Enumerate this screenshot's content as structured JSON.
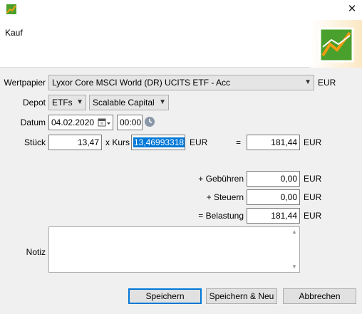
{
  "window": {
    "title": "Kauf",
    "close_glyph": "✕",
    "app_icon": "chart-app-icon",
    "header_icon": "chart-logo-icon"
  },
  "form": {
    "wertpapier": {
      "label": "Wertpapier",
      "value": "Lyxor Core MSCI World (DR) UCITS ETF - Acc",
      "currency": "EUR"
    },
    "depot": {
      "label": "Depot",
      "portfolio_value": "ETFs",
      "account_value": "Scalable Capital"
    },
    "datum": {
      "label": "Datum",
      "date_value": "04.02.2020",
      "time_value": "00:00"
    },
    "stueck": {
      "label": "Stück",
      "value": "13,47"
    },
    "kurs": {
      "label": "x Kurs",
      "value": "13,46993318",
      "currency": "EUR"
    },
    "equals": "=",
    "total": {
      "value": "181,44",
      "currency": "EUR"
    },
    "gebuehren": {
      "label": "+ Gebühren",
      "value": "0,00",
      "currency": "EUR"
    },
    "steuern": {
      "label": "+ Steuern",
      "value": "0,00",
      "currency": "EUR"
    },
    "belastung": {
      "label": "= Belastung",
      "value": "181,44",
      "currency": "EUR"
    },
    "notiz": {
      "label": "Notiz",
      "value": ""
    }
  },
  "buttons": {
    "save": "Speichern",
    "save_new": "Speichern & Neu",
    "cancel": "Abbrechen"
  },
  "colors": {
    "selection": "#0078d7",
    "default_button_border": "#0078d7",
    "logo_green": "#4aa02c",
    "logo_orange": "#f39c12"
  }
}
